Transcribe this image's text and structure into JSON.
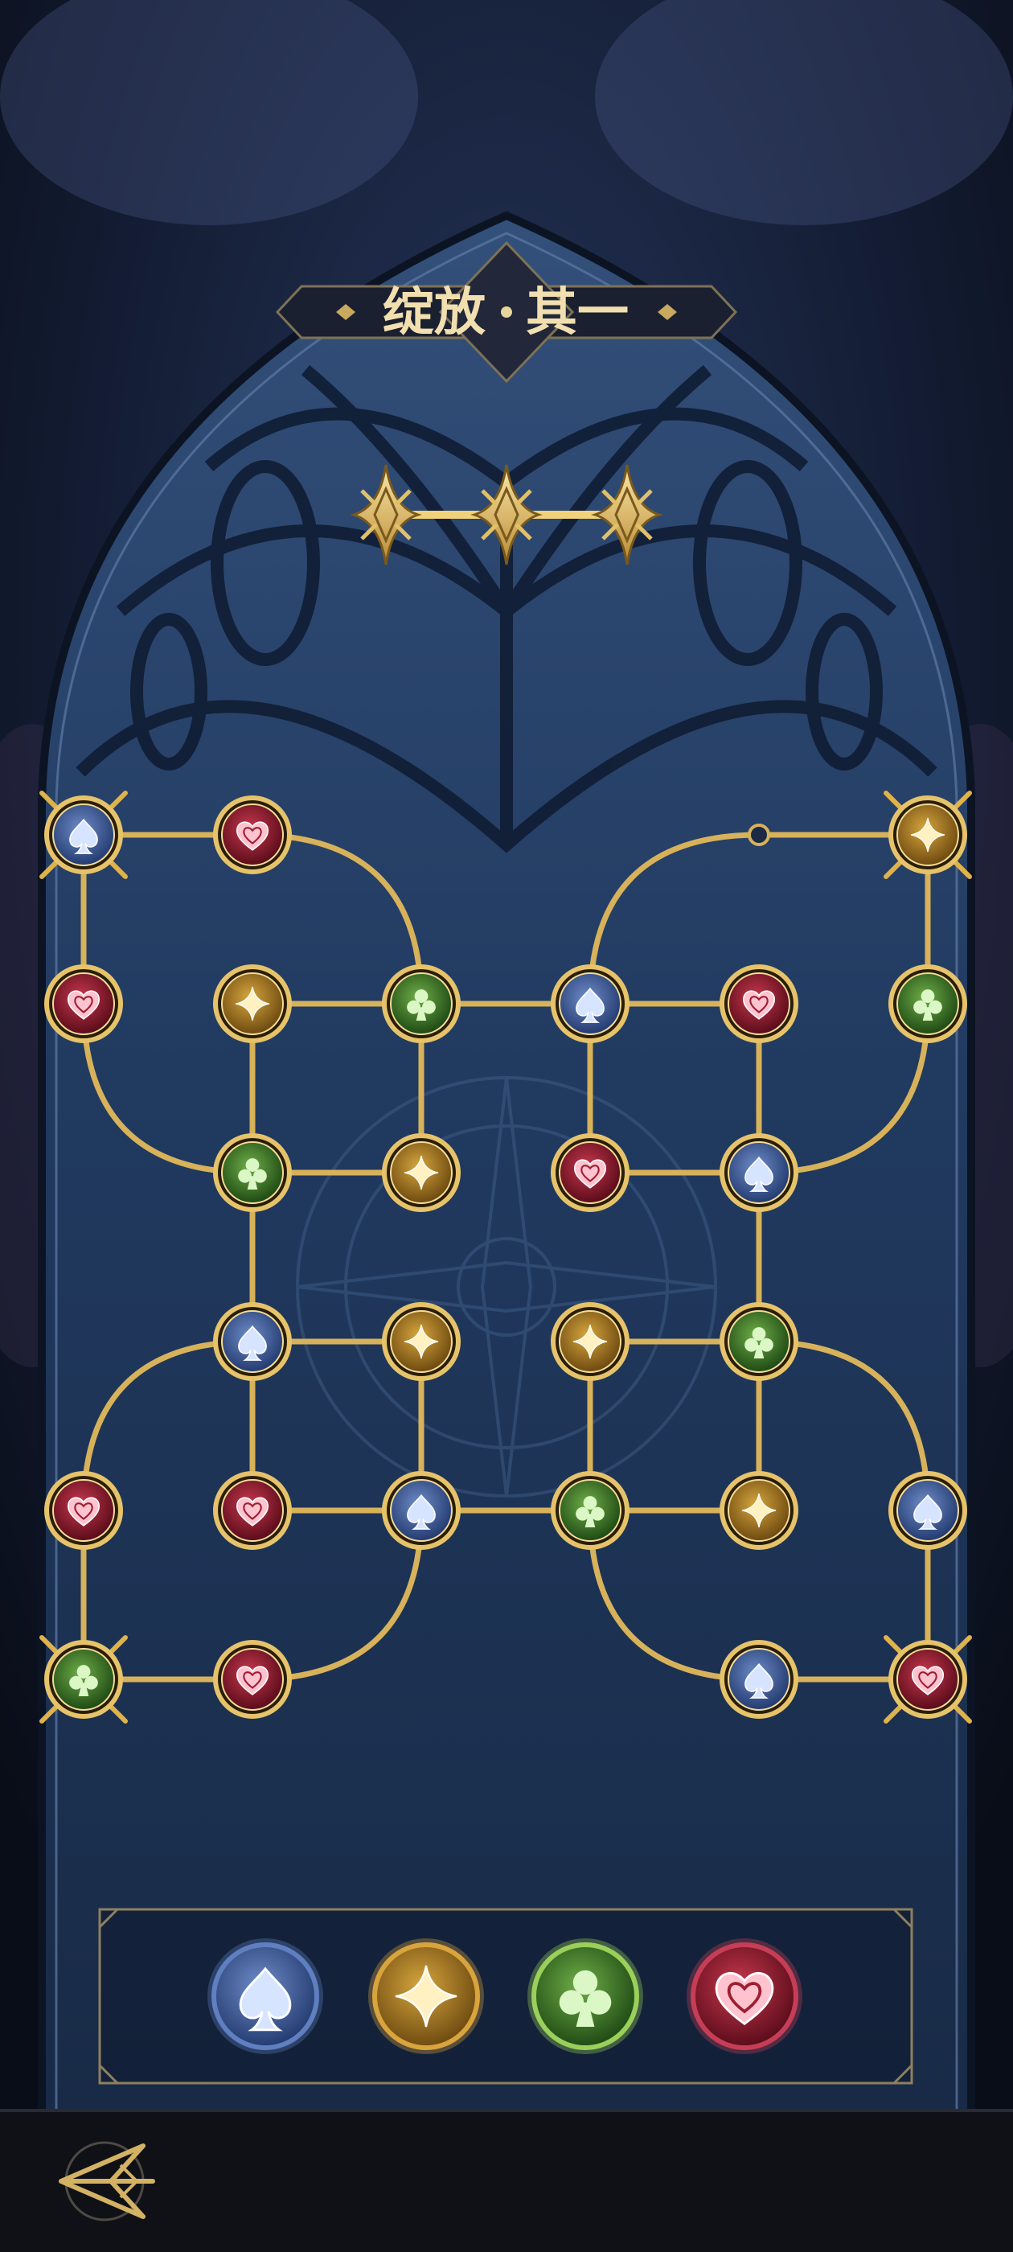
{
  "title": {
    "part1": "绽放",
    "part2": "其一"
  },
  "progress": {
    "total_stars": 3,
    "lit_stars": 3
  },
  "colors": {
    "gold": "#d8b25a",
    "spade": "#3a5a96",
    "diamond": "#b78a24",
    "club": "#3f7a2a",
    "heart": "#9c1e32"
  },
  "suits": {
    "spade": {
      "icon": "spade-icon"
    },
    "diamond": {
      "icon": "diamond-star-icon"
    },
    "club": {
      "icon": "club-icon"
    },
    "heart": {
      "icon": "heart-icon"
    }
  },
  "board": {
    "rows": [
      [
        "spade",
        "heart",
        null,
        null,
        null,
        "diamond"
      ],
      [
        "heart",
        "diamond",
        "club",
        "spade",
        "heart",
        "club"
      ],
      [
        null,
        "club",
        "diamond",
        "heart",
        "spade",
        null
      ],
      [
        null,
        "spade",
        "diamond",
        "diamond",
        "club",
        null
      ],
      [
        "heart",
        "heart",
        "spade",
        "club",
        "diamond",
        "spade"
      ],
      [
        "club",
        "heart",
        null,
        null,
        "spade",
        "heart"
      ]
    ],
    "corner_marked": [
      "0-0",
      "0-5",
      "5-0",
      "5-5"
    ]
  },
  "selector": {
    "options": [
      "spade",
      "diamond",
      "club",
      "heart"
    ]
  },
  "back_button": {
    "icon": "back-arrow-icon"
  }
}
